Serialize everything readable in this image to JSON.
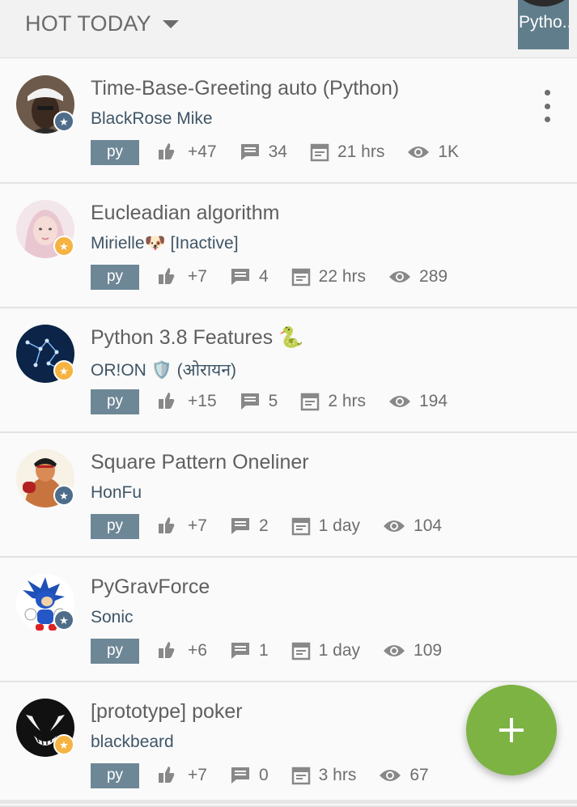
{
  "header": {
    "filter_label": "HOT TODAY",
    "language_tab": "Pytho.."
  },
  "posts": [
    {
      "title": "Time-Base-Greeting auto (Python)",
      "author": "BlackRose Mike",
      "tag": "py",
      "votes": "+47",
      "comments": "34",
      "time": "21 hrs",
      "views": "1K",
      "badge": "star",
      "badge_color": "#4f6d8a",
      "avatar_icon": "person-avatar"
    },
    {
      "title": "Eucleadian algorithm",
      "author": "Mirielle🐶 [Inactive]",
      "tag": "py",
      "votes": "+7",
      "comments": "4",
      "time": "22 hrs",
      "views": "289",
      "badge": "star",
      "badge_color": "#f5b342",
      "avatar_icon": "person-avatar"
    },
    {
      "title": "Python 3.8 Features 🐍",
      "author": "OR!ON 🛡️ (ओरायन)",
      "tag": "py",
      "votes": "+15",
      "comments": "5",
      "time": "2 hrs",
      "views": "194",
      "badge": "star",
      "badge_color": "#f5b342",
      "avatar_icon": "constellation-avatar"
    },
    {
      "title": "Square Pattern Oneliner",
      "author": "HonFu",
      "tag": "py",
      "votes": "+7",
      "comments": "2",
      "time": "1 day",
      "views": "104",
      "badge": "star",
      "badge_color": "#4f6d8a",
      "avatar_icon": "fighter-avatar"
    },
    {
      "title": "PyGravForce",
      "author": "Sonic",
      "tag": "py",
      "votes": "+6",
      "comments": "1",
      "time": "1 day",
      "views": "109",
      "badge": "star",
      "badge_color": "#4f6d8a",
      "avatar_icon": "hedgehog-avatar"
    },
    {
      "title": "[prototype] poker",
      "author": "blackbeard",
      "tag": "py",
      "votes": "+7",
      "comments": "0",
      "time": "3 hrs",
      "views": "67",
      "badge": "star",
      "badge_color": "#f5b342",
      "avatar_icon": "venom-avatar"
    }
  ],
  "fab": {
    "icon": "plus-icon",
    "color": "#7cb342"
  },
  "colors": {
    "tag": "#6e8796",
    "author": "#3f5566",
    "title": "#5f5f5f"
  }
}
